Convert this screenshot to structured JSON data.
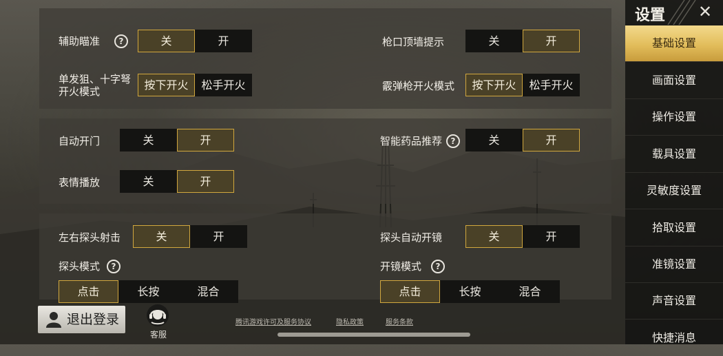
{
  "sidebar": {
    "title": "设置",
    "items": [
      {
        "label": "基础设置",
        "active": true
      },
      {
        "label": "画面设置"
      },
      {
        "label": "操作设置"
      },
      {
        "label": "载具设置"
      },
      {
        "label": "灵敏度设置"
      },
      {
        "label": "拾取设置"
      },
      {
        "label": "准镜设置"
      },
      {
        "label": "声音设置"
      },
      {
        "label": "快捷消息"
      }
    ]
  },
  "section1": {
    "aim_assist": {
      "label": "辅助瞄准",
      "off": "关",
      "on": "开",
      "selected": "关"
    },
    "wall_hint": {
      "label": "枪口顶墙提示",
      "off": "关",
      "on": "开",
      "selected": "开"
    },
    "sniper_fire": {
      "label_line1": "单发狙、十字弩",
      "label_line2": "开火模式",
      "press": "按下开火",
      "release": "松手开火",
      "selected": "按下开火"
    },
    "shotgun_fire": {
      "label": "霰弹枪开火模式",
      "press": "按下开火",
      "release": "松手开火",
      "selected": "按下开火"
    }
  },
  "section2": {
    "auto_door": {
      "label": "自动开门",
      "off": "关",
      "on": "开",
      "selected": "开"
    },
    "med_recommend": {
      "label": "智能药品推荐",
      "off": "关",
      "on": "开",
      "selected": "开"
    },
    "emote": {
      "label": "表情播放",
      "off": "关",
      "on": "开",
      "selected": "开"
    }
  },
  "section3": {
    "peek_fire": {
      "label": "左右探头射击",
      "off": "关",
      "on": "开",
      "selected": "关"
    },
    "peek_scope": {
      "label": "探头自动开镜",
      "off": "关",
      "on": "开",
      "selected": "关"
    },
    "peek_mode": {
      "label": "探头模式",
      "options": [
        "点击",
        "长按",
        "混合"
      ],
      "selected": "点击"
    },
    "scope_mode": {
      "label": "开镜模式",
      "options": [
        "点击",
        "长按",
        "混合"
      ],
      "selected": "点击"
    }
  },
  "footer": {
    "logout": "退出登录",
    "customer_service": "客服",
    "links": [
      "腾讯游戏许可及服务协议",
      "隐私政策",
      "服务条款"
    ]
  },
  "colors": {
    "accent": "#d2a83e",
    "active_tab": "#e2bd5b",
    "off_bg": "#141412"
  }
}
